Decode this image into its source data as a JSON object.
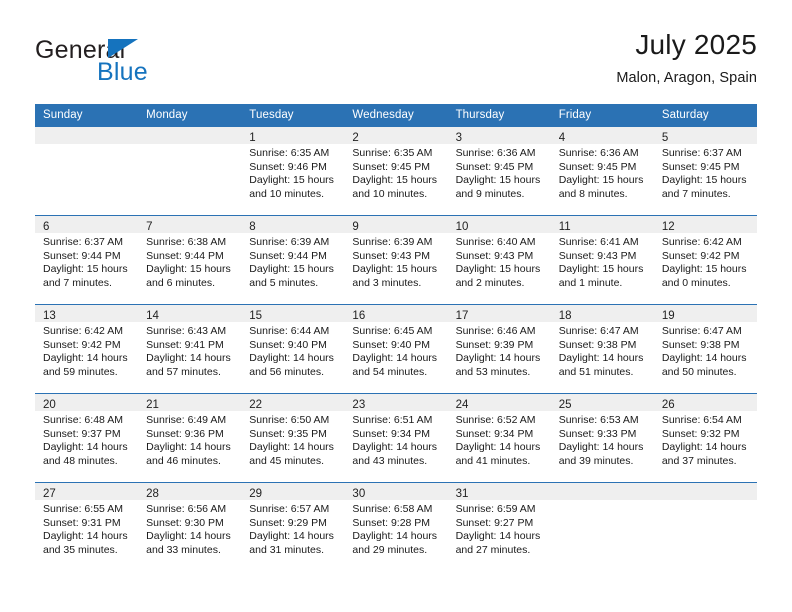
{
  "brand": {
    "name_top": "General",
    "name_bottom": "Blue",
    "triangle_color": "#1573be",
    "text_color": "#231f20"
  },
  "header": {
    "title": "July 2025",
    "subtitle": "Malon, Aragon, Spain"
  },
  "theme": {
    "header_blue": "#2b72b4",
    "daynum_band": "#efefef",
    "text": "#1a1a1a"
  },
  "weekdays": [
    "Sunday",
    "Monday",
    "Tuesday",
    "Wednesday",
    "Thursday",
    "Friday",
    "Saturday"
  ],
  "weeks": [
    [
      {
        "day": "",
        "sunrise": "",
        "sunset": "",
        "daylight1": "",
        "daylight2": "",
        "empty": true
      },
      {
        "day": "",
        "sunrise": "",
        "sunset": "",
        "daylight1": "",
        "daylight2": "",
        "empty": true
      },
      {
        "day": "1",
        "sunrise": "Sunrise: 6:35 AM",
        "sunset": "Sunset: 9:46 PM",
        "daylight1": "Daylight: 15 hours",
        "daylight2": "and 10 minutes."
      },
      {
        "day": "2",
        "sunrise": "Sunrise: 6:35 AM",
        "sunset": "Sunset: 9:45 PM",
        "daylight1": "Daylight: 15 hours",
        "daylight2": "and 10 minutes."
      },
      {
        "day": "3",
        "sunrise": "Sunrise: 6:36 AM",
        "sunset": "Sunset: 9:45 PM",
        "daylight1": "Daylight: 15 hours",
        "daylight2": "and 9 minutes."
      },
      {
        "day": "4",
        "sunrise": "Sunrise: 6:36 AM",
        "sunset": "Sunset: 9:45 PM",
        "daylight1": "Daylight: 15 hours",
        "daylight2": "and 8 minutes."
      },
      {
        "day": "5",
        "sunrise": "Sunrise: 6:37 AM",
        "sunset": "Sunset: 9:45 PM",
        "daylight1": "Daylight: 15 hours",
        "daylight2": "and 7 minutes."
      }
    ],
    [
      {
        "day": "6",
        "sunrise": "Sunrise: 6:37 AM",
        "sunset": "Sunset: 9:44 PM",
        "daylight1": "Daylight: 15 hours",
        "daylight2": "and 7 minutes."
      },
      {
        "day": "7",
        "sunrise": "Sunrise: 6:38 AM",
        "sunset": "Sunset: 9:44 PM",
        "daylight1": "Daylight: 15 hours",
        "daylight2": "and 6 minutes."
      },
      {
        "day": "8",
        "sunrise": "Sunrise: 6:39 AM",
        "sunset": "Sunset: 9:44 PM",
        "daylight1": "Daylight: 15 hours",
        "daylight2": "and 5 minutes."
      },
      {
        "day": "9",
        "sunrise": "Sunrise: 6:39 AM",
        "sunset": "Sunset: 9:43 PM",
        "daylight1": "Daylight: 15 hours",
        "daylight2": "and 3 minutes."
      },
      {
        "day": "10",
        "sunrise": "Sunrise: 6:40 AM",
        "sunset": "Sunset: 9:43 PM",
        "daylight1": "Daylight: 15 hours",
        "daylight2": "and 2 minutes."
      },
      {
        "day": "11",
        "sunrise": "Sunrise: 6:41 AM",
        "sunset": "Sunset: 9:43 PM",
        "daylight1": "Daylight: 15 hours",
        "daylight2": "and 1 minute."
      },
      {
        "day": "12",
        "sunrise": "Sunrise: 6:42 AM",
        "sunset": "Sunset: 9:42 PM",
        "daylight1": "Daylight: 15 hours",
        "daylight2": "and 0 minutes."
      }
    ],
    [
      {
        "day": "13",
        "sunrise": "Sunrise: 6:42 AM",
        "sunset": "Sunset: 9:42 PM",
        "daylight1": "Daylight: 14 hours",
        "daylight2": "and 59 minutes."
      },
      {
        "day": "14",
        "sunrise": "Sunrise: 6:43 AM",
        "sunset": "Sunset: 9:41 PM",
        "daylight1": "Daylight: 14 hours",
        "daylight2": "and 57 minutes."
      },
      {
        "day": "15",
        "sunrise": "Sunrise: 6:44 AM",
        "sunset": "Sunset: 9:40 PM",
        "daylight1": "Daylight: 14 hours",
        "daylight2": "and 56 minutes."
      },
      {
        "day": "16",
        "sunrise": "Sunrise: 6:45 AM",
        "sunset": "Sunset: 9:40 PM",
        "daylight1": "Daylight: 14 hours",
        "daylight2": "and 54 minutes."
      },
      {
        "day": "17",
        "sunrise": "Sunrise: 6:46 AM",
        "sunset": "Sunset: 9:39 PM",
        "daylight1": "Daylight: 14 hours",
        "daylight2": "and 53 minutes."
      },
      {
        "day": "18",
        "sunrise": "Sunrise: 6:47 AM",
        "sunset": "Sunset: 9:38 PM",
        "daylight1": "Daylight: 14 hours",
        "daylight2": "and 51 minutes."
      },
      {
        "day": "19",
        "sunrise": "Sunrise: 6:47 AM",
        "sunset": "Sunset: 9:38 PM",
        "daylight1": "Daylight: 14 hours",
        "daylight2": "and 50 minutes."
      }
    ],
    [
      {
        "day": "20",
        "sunrise": "Sunrise: 6:48 AM",
        "sunset": "Sunset: 9:37 PM",
        "daylight1": "Daylight: 14 hours",
        "daylight2": "and 48 minutes."
      },
      {
        "day": "21",
        "sunrise": "Sunrise: 6:49 AM",
        "sunset": "Sunset: 9:36 PM",
        "daylight1": "Daylight: 14 hours",
        "daylight2": "and 46 minutes."
      },
      {
        "day": "22",
        "sunrise": "Sunrise: 6:50 AM",
        "sunset": "Sunset: 9:35 PM",
        "daylight1": "Daylight: 14 hours",
        "daylight2": "and 45 minutes."
      },
      {
        "day": "23",
        "sunrise": "Sunrise: 6:51 AM",
        "sunset": "Sunset: 9:34 PM",
        "daylight1": "Daylight: 14 hours",
        "daylight2": "and 43 minutes."
      },
      {
        "day": "24",
        "sunrise": "Sunrise: 6:52 AM",
        "sunset": "Sunset: 9:34 PM",
        "daylight1": "Daylight: 14 hours",
        "daylight2": "and 41 minutes."
      },
      {
        "day": "25",
        "sunrise": "Sunrise: 6:53 AM",
        "sunset": "Sunset: 9:33 PM",
        "daylight1": "Daylight: 14 hours",
        "daylight2": "and 39 minutes."
      },
      {
        "day": "26",
        "sunrise": "Sunrise: 6:54 AM",
        "sunset": "Sunset: 9:32 PM",
        "daylight1": "Daylight: 14 hours",
        "daylight2": "and 37 minutes."
      }
    ],
    [
      {
        "day": "27",
        "sunrise": "Sunrise: 6:55 AM",
        "sunset": "Sunset: 9:31 PM",
        "daylight1": "Daylight: 14 hours",
        "daylight2": "and 35 minutes."
      },
      {
        "day": "28",
        "sunrise": "Sunrise: 6:56 AM",
        "sunset": "Sunset: 9:30 PM",
        "daylight1": "Daylight: 14 hours",
        "daylight2": "and 33 minutes."
      },
      {
        "day": "29",
        "sunrise": "Sunrise: 6:57 AM",
        "sunset": "Sunset: 9:29 PM",
        "daylight1": "Daylight: 14 hours",
        "daylight2": "and 31 minutes."
      },
      {
        "day": "30",
        "sunrise": "Sunrise: 6:58 AM",
        "sunset": "Sunset: 9:28 PM",
        "daylight1": "Daylight: 14 hours",
        "daylight2": "and 29 minutes."
      },
      {
        "day": "31",
        "sunrise": "Sunrise: 6:59 AM",
        "sunset": "Sunset: 9:27 PM",
        "daylight1": "Daylight: 14 hours",
        "daylight2": "and 27 minutes."
      },
      {
        "day": "",
        "sunrise": "",
        "sunset": "",
        "daylight1": "",
        "daylight2": "",
        "empty": true
      },
      {
        "day": "",
        "sunrise": "",
        "sunset": "",
        "daylight1": "",
        "daylight2": "",
        "empty": true
      }
    ]
  ]
}
